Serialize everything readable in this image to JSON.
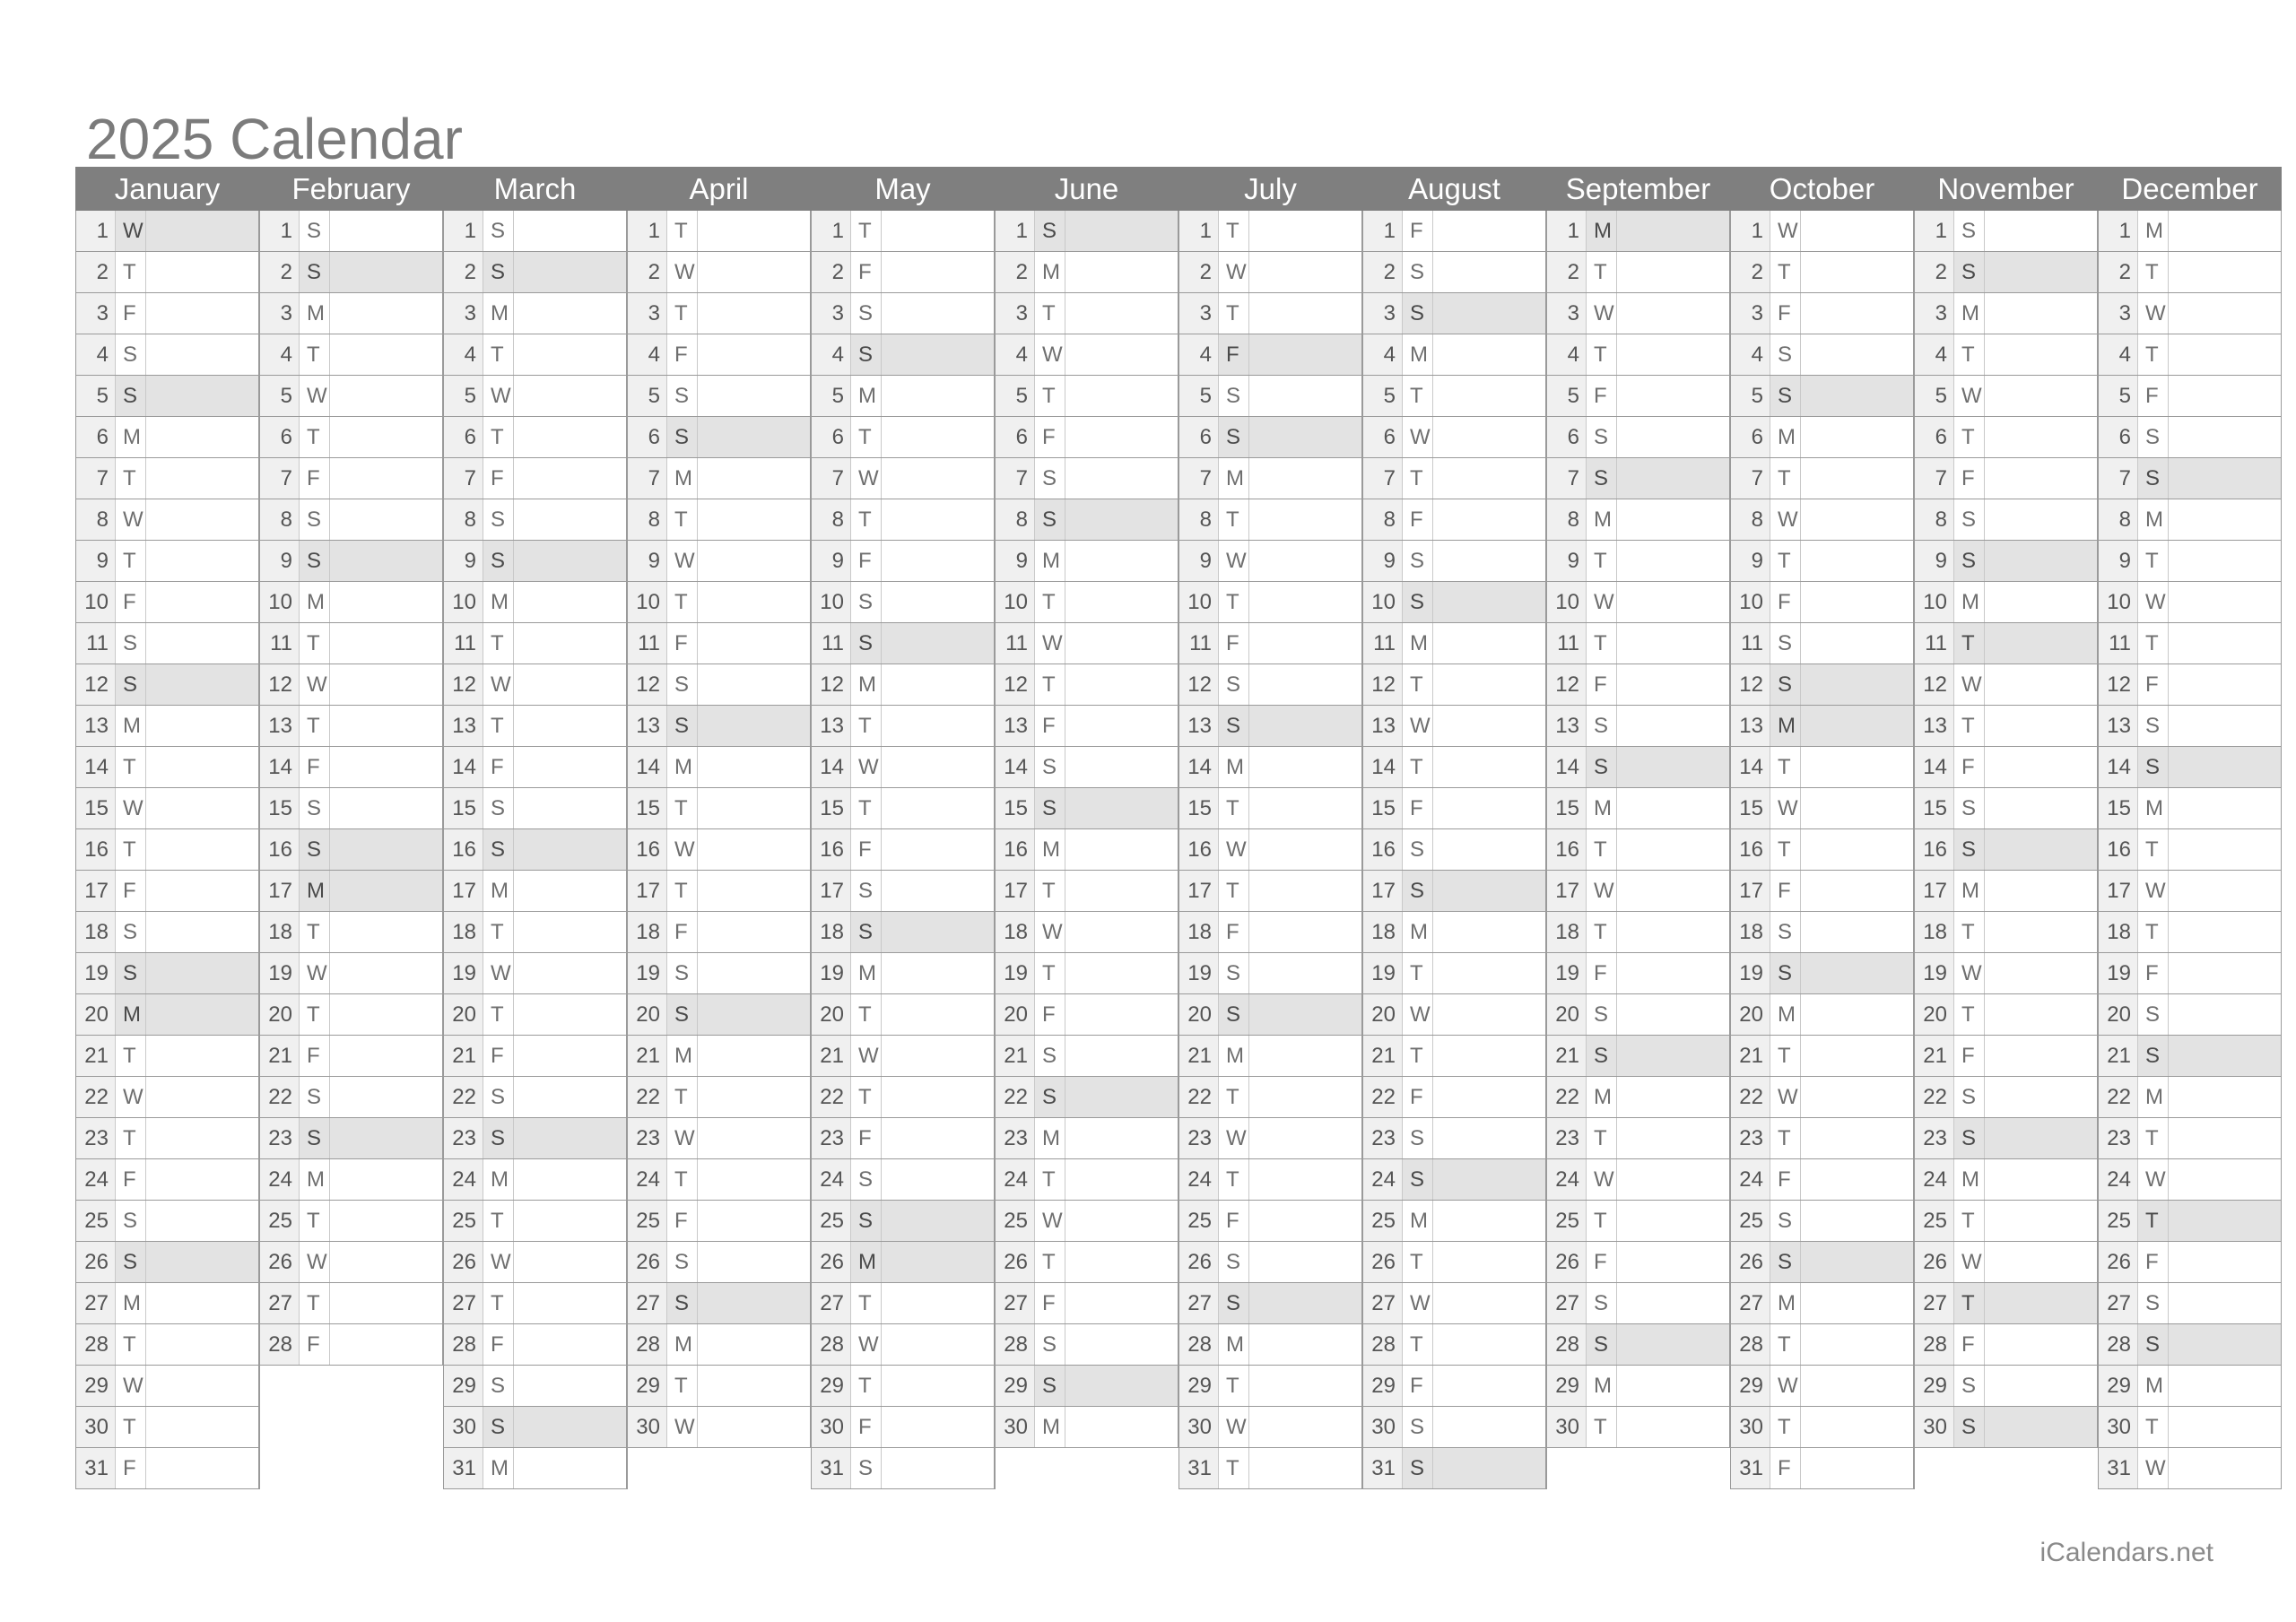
{
  "page": {
    "title": "2025 Calendar",
    "footer": "iCalendars.net",
    "background_color": "#ffffff",
    "header_bar_color": "#7f7f7f",
    "header_text_color": "#ffffff",
    "title_color": "#7b7b7b",
    "date_cell_color": "#f0f0f0",
    "highlight_color": "#e3e3e3",
    "grid_line_color": "#9a9a9a"
  },
  "months": [
    {
      "name": "January",
      "days": 31,
      "first_weekday": "W",
      "dow": [
        "W",
        "T",
        "F",
        "S",
        "S",
        "M",
        "T",
        "W",
        "T",
        "F",
        "S",
        "S",
        "M",
        "T",
        "W",
        "T",
        "F",
        "S",
        "S",
        "M",
        "T",
        "W",
        "T",
        "F",
        "S",
        "S",
        "M",
        "T",
        "W",
        "T",
        "F"
      ],
      "highlighted": [
        1,
        5,
        12,
        19,
        20,
        26
      ]
    },
    {
      "name": "February",
      "days": 28,
      "first_weekday": "S",
      "dow": [
        "S",
        "S",
        "M",
        "T",
        "W",
        "T",
        "F",
        "S",
        "S",
        "M",
        "T",
        "W",
        "T",
        "F",
        "S",
        "S",
        "M",
        "T",
        "W",
        "T",
        "F",
        "S",
        "S",
        "M",
        "T",
        "W",
        "T",
        "F"
      ],
      "highlighted": [
        2,
        9,
        16,
        17,
        23
      ]
    },
    {
      "name": "March",
      "days": 31,
      "first_weekday": "S",
      "dow": [
        "S",
        "S",
        "M",
        "T",
        "W",
        "T",
        "F",
        "S",
        "S",
        "M",
        "T",
        "W",
        "T",
        "F",
        "S",
        "S",
        "M",
        "T",
        "W",
        "T",
        "F",
        "S",
        "S",
        "M",
        "T",
        "W",
        "T",
        "F",
        "S",
        "S",
        "M"
      ],
      "highlighted": [
        2,
        9,
        16,
        23,
        30
      ]
    },
    {
      "name": "April",
      "days": 30,
      "first_weekday": "T",
      "dow": [
        "T",
        "W",
        "T",
        "F",
        "S",
        "S",
        "M",
        "T",
        "W",
        "T",
        "F",
        "S",
        "S",
        "M",
        "T",
        "W",
        "T",
        "F",
        "S",
        "S",
        "M",
        "T",
        "W",
        "T",
        "F",
        "S",
        "S",
        "M",
        "T",
        "W"
      ],
      "highlighted": [
        6,
        13,
        20,
        27
      ]
    },
    {
      "name": "May",
      "days": 31,
      "first_weekday": "T",
      "dow": [
        "T",
        "F",
        "S",
        "S",
        "M",
        "T",
        "W",
        "T",
        "F",
        "S",
        "S",
        "M",
        "T",
        "W",
        "T",
        "F",
        "S",
        "S",
        "M",
        "T",
        "W",
        "T",
        "F",
        "S",
        "S",
        "M",
        "T",
        "W",
        "T",
        "F",
        "S"
      ],
      "highlighted": [
        4,
        11,
        18,
        25,
        26
      ]
    },
    {
      "name": "June",
      "days": 30,
      "first_weekday": "S",
      "dow": [
        "S",
        "M",
        "T",
        "W",
        "T",
        "F",
        "S",
        "S",
        "M",
        "T",
        "W",
        "T",
        "F",
        "S",
        "S",
        "M",
        "T",
        "W",
        "T",
        "F",
        "S",
        "S",
        "M",
        "T",
        "W",
        "T",
        "F",
        "S",
        "S",
        "M"
      ],
      "highlighted": [
        1,
        8,
        15,
        22,
        29
      ]
    },
    {
      "name": "July",
      "days": 31,
      "first_weekday": "T",
      "dow": [
        "T",
        "W",
        "T",
        "F",
        "S",
        "S",
        "M",
        "T",
        "W",
        "T",
        "F",
        "S",
        "S",
        "M",
        "T",
        "W",
        "T",
        "F",
        "S",
        "S",
        "M",
        "T",
        "W",
        "T",
        "F",
        "S",
        "S",
        "M",
        "T",
        "W",
        "T"
      ],
      "highlighted": [
        4,
        6,
        13,
        20,
        27
      ]
    },
    {
      "name": "August",
      "days": 31,
      "first_weekday": "F",
      "dow": [
        "F",
        "S",
        "S",
        "M",
        "T",
        "W",
        "T",
        "F",
        "S",
        "S",
        "M",
        "T",
        "W",
        "T",
        "F",
        "S",
        "S",
        "M",
        "T",
        "W",
        "T",
        "F",
        "S",
        "S",
        "M",
        "T",
        "W",
        "T",
        "F",
        "S",
        "S"
      ],
      "highlighted": [
        3,
        10,
        17,
        24,
        31
      ]
    },
    {
      "name": "September",
      "days": 30,
      "first_weekday": "M",
      "dow": [
        "M",
        "T",
        "W",
        "T",
        "F",
        "S",
        "S",
        "M",
        "T",
        "W",
        "T",
        "F",
        "S",
        "S",
        "M",
        "T",
        "W",
        "T",
        "F",
        "S",
        "S",
        "M",
        "T",
        "W",
        "T",
        "F",
        "S",
        "S",
        "M",
        "T"
      ],
      "highlighted": [
        1,
        7,
        14,
        21,
        28
      ]
    },
    {
      "name": "October",
      "days": 31,
      "first_weekday": "W",
      "dow": [
        "W",
        "T",
        "F",
        "S",
        "S",
        "M",
        "T",
        "W",
        "T",
        "F",
        "S",
        "S",
        "M",
        "T",
        "W",
        "T",
        "F",
        "S",
        "S",
        "M",
        "T",
        "W",
        "T",
        "F",
        "S",
        "S",
        "M",
        "T",
        "W",
        "T",
        "F"
      ],
      "highlighted": [
        5,
        12,
        13,
        19,
        26
      ]
    },
    {
      "name": "November",
      "days": 30,
      "first_weekday": "S",
      "dow": [
        "S",
        "S",
        "M",
        "T",
        "W",
        "T",
        "F",
        "S",
        "S",
        "M",
        "T",
        "W",
        "T",
        "F",
        "S",
        "S",
        "M",
        "T",
        "W",
        "T",
        "F",
        "S",
        "S",
        "M",
        "T",
        "W",
        "T",
        "F",
        "S",
        "S"
      ],
      "highlighted": [
        2,
        9,
        11,
        16,
        23,
        27,
        30
      ]
    },
    {
      "name": "December",
      "days": 31,
      "first_weekday": "M",
      "dow": [
        "M",
        "T",
        "W",
        "T",
        "F",
        "S",
        "S",
        "M",
        "T",
        "W",
        "T",
        "F",
        "S",
        "S",
        "M",
        "T",
        "W",
        "T",
        "F",
        "S",
        "S",
        "M",
        "T",
        "W",
        "T",
        "F",
        "S",
        "S",
        "M",
        "T",
        "W"
      ],
      "highlighted": [
        7,
        14,
        21,
        25,
        28
      ]
    }
  ]
}
